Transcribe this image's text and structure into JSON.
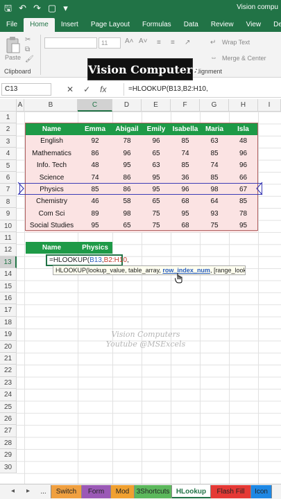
{
  "titlebar": {
    "doc_title": "Vision compu"
  },
  "ribbon_tabs": [
    "File",
    "Home",
    "Insert",
    "Page Layout",
    "Formulas",
    "Data",
    "Review",
    "View",
    "Develop"
  ],
  "ribbon": {
    "paste": "Paste",
    "clipboard": "Clipboard",
    "font_size": "11",
    "wrap_text": "Wrap Text",
    "merge_center": "Merge & Center",
    "alignment": "Alignment"
  },
  "banner": "Vision Computers",
  "formula_bar": {
    "name_box": "C13",
    "cancel": "✕",
    "enter": "✓",
    "fx": "fx",
    "formula": "=HLOOKUP(B13,B2:H10,"
  },
  "columns": [
    "A",
    "B",
    "C",
    "D",
    "E",
    "F",
    "G",
    "H",
    "I"
  ],
  "rows": [
    "1",
    "2",
    "3",
    "4",
    "5",
    "6",
    "7",
    "8",
    "9",
    "10",
    "11",
    "12",
    "13",
    "14",
    "15",
    "16",
    "17",
    "18",
    "19",
    "20",
    "21",
    "22",
    "23",
    "24",
    "25",
    "26",
    "27",
    "28",
    "29",
    "30"
  ],
  "table": {
    "headers": [
      "Name",
      "Emma",
      "Abigail",
      "Emily",
      "Isabella",
      "Maria",
      "Isla"
    ],
    "rows": [
      [
        "English",
        "92",
        "78",
        "96",
        "85",
        "63",
        "48"
      ],
      [
        "Mathematics",
        "86",
        "96",
        "65",
        "74",
        "85",
        "96"
      ],
      [
        "Info. Tech",
        "48",
        "95",
        "63",
        "85",
        "74",
        "96"
      ],
      [
        "Science",
        "74",
        "86",
        "95",
        "36",
        "85",
        "66"
      ],
      [
        "Physics",
        "85",
        "86",
        "95",
        "96",
        "98",
        "67"
      ],
      [
        "Chemistry",
        "46",
        "58",
        "65",
        "68",
        "64",
        "85"
      ],
      [
        "Com Sci",
        "89",
        "98",
        "75",
        "95",
        "93",
        "78"
      ],
      [
        "Social Studies",
        "95",
        "65",
        "75",
        "68",
        "75",
        "95"
      ]
    ]
  },
  "lookup": {
    "name_header": "Name",
    "physics_header": "Physics"
  },
  "editing": {
    "prefix": "=HLOOKUP(",
    "ref1": "B13",
    "comma1": ",",
    "ref2": "B2:H10",
    "suffix": ","
  },
  "tooltip": {
    "before": "HLOOKUP(lookup_value, table_array, ",
    "bold": "row_index_num",
    "after": ", [range_lookup])"
  },
  "watermark": {
    "line1": "Vision Computers",
    "line2": "Youtube @MSExcels"
  },
  "sheet_tabs": [
    {
      "label": "...",
      "color": "#f3f3f3"
    },
    {
      "label": "Switch",
      "color": "#f0a040"
    },
    {
      "label": "Form",
      "color": "#9b59b6"
    },
    {
      "label": "Mod",
      "color": "#f0a030"
    },
    {
      "label": "3Shortcuts",
      "color": "#5cb85c"
    },
    {
      "label": "HLookup",
      "color": "#ffffff"
    },
    {
      "label": "Flash Fill",
      "color": "#e53935"
    },
    {
      "label": "Icon",
      "color": "#1e88e5"
    }
  ],
  "colors": {
    "excel_green": "#217346",
    "header_green": "#1e9a47",
    "data_pink": "#fbe3e3"
  }
}
